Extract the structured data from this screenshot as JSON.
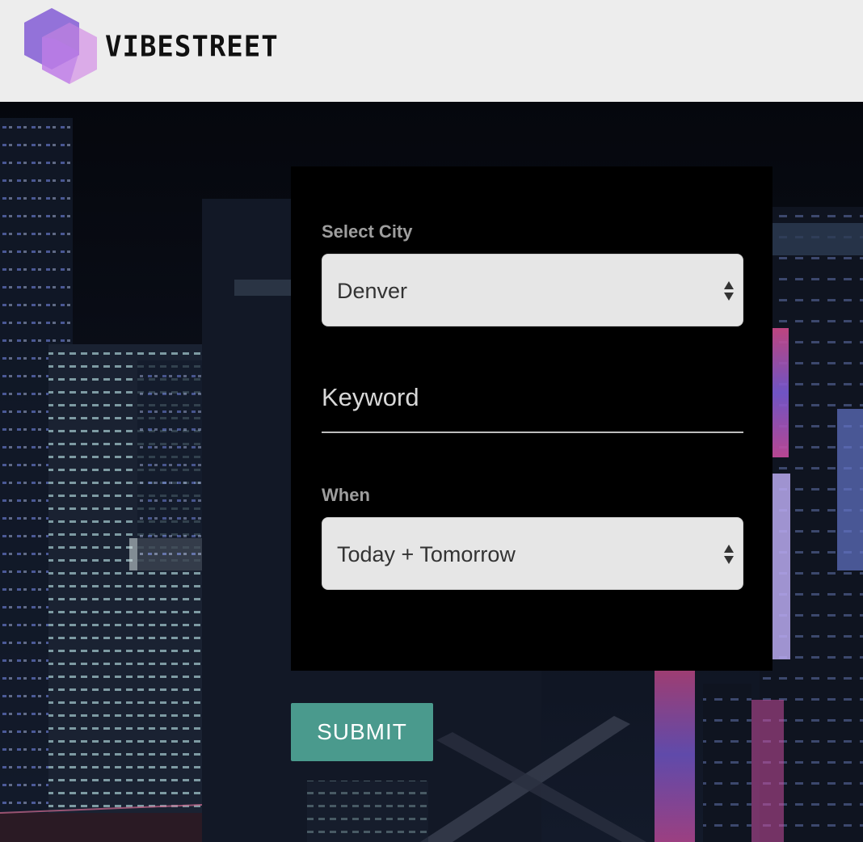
{
  "header": {
    "brand_name": "VIBESTREET"
  },
  "form": {
    "city_label": "Select City",
    "city_value": "Denver",
    "keyword_placeholder": "Keyword",
    "when_label": "When",
    "when_value": "Today + Tomorrow",
    "submit_label": "SUBMIT"
  },
  "colors": {
    "header_bg": "#ededed",
    "panel_bg": "#000000",
    "submit_bg": "#4a9a8d",
    "label_text": "#9e9e9e"
  },
  "icons": [
    "hexagon-logo-icon",
    "select-arrows-icon"
  ]
}
